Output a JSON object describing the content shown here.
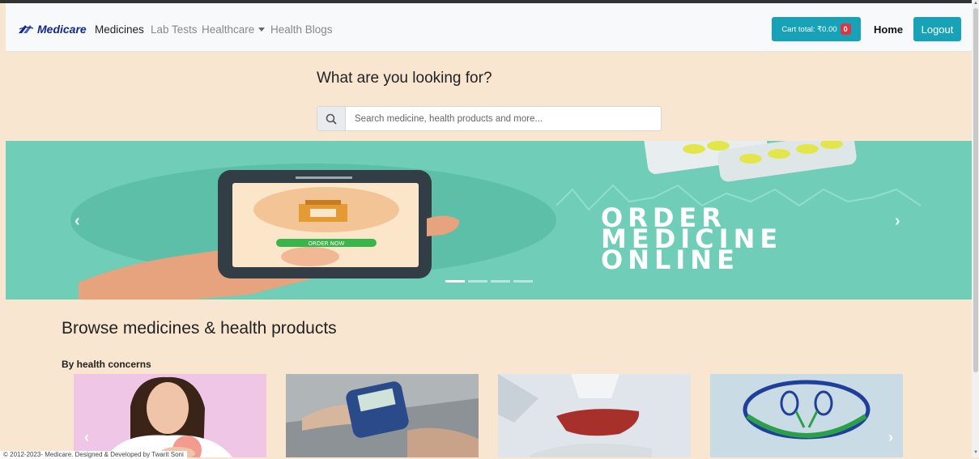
{
  "navbar": {
    "brand": "Medicare",
    "links": [
      {
        "label": "Medicines",
        "active": true
      },
      {
        "label": "Lab Tests",
        "active": false
      },
      {
        "label": "Healthcare",
        "dropdown": true
      },
      {
        "label": "Health Blogs",
        "active": false
      }
    ],
    "cart_label": "Cart total: ₹0.00",
    "cart_count": "0",
    "home": "Home",
    "logout": "Logout"
  },
  "search": {
    "heading": "What are you looking for?",
    "placeholder": "Search medicine, health products and more..."
  },
  "carousel": {
    "slide_text": [
      "ORDER",
      "MEDICINE",
      "ONLINE"
    ],
    "button_text": "ORDER NOW",
    "prev": "‹",
    "next": "›",
    "indicator_count": 4,
    "active_index": 0
  },
  "browse": {
    "heading": "Browse medicines & health products",
    "subheading": "By health concerns",
    "cards": [
      {
        "icon": "chest-pain-photo"
      },
      {
        "icon": "glucometer-photo"
      },
      {
        "icon": "liver-photo"
      },
      {
        "icon": "kidney-logo"
      }
    ],
    "prev": "‹",
    "next": "›"
  },
  "footer": {
    "text": "© 2012-2023- Medicare. Designed & Developed by Twarit Soni"
  },
  "colors": {
    "accent": "#17a2b8",
    "badge": "#dc3545",
    "page_bg": "#f9e6d1",
    "banner_bg": "#6fcdb8",
    "brand": "#15298a"
  }
}
